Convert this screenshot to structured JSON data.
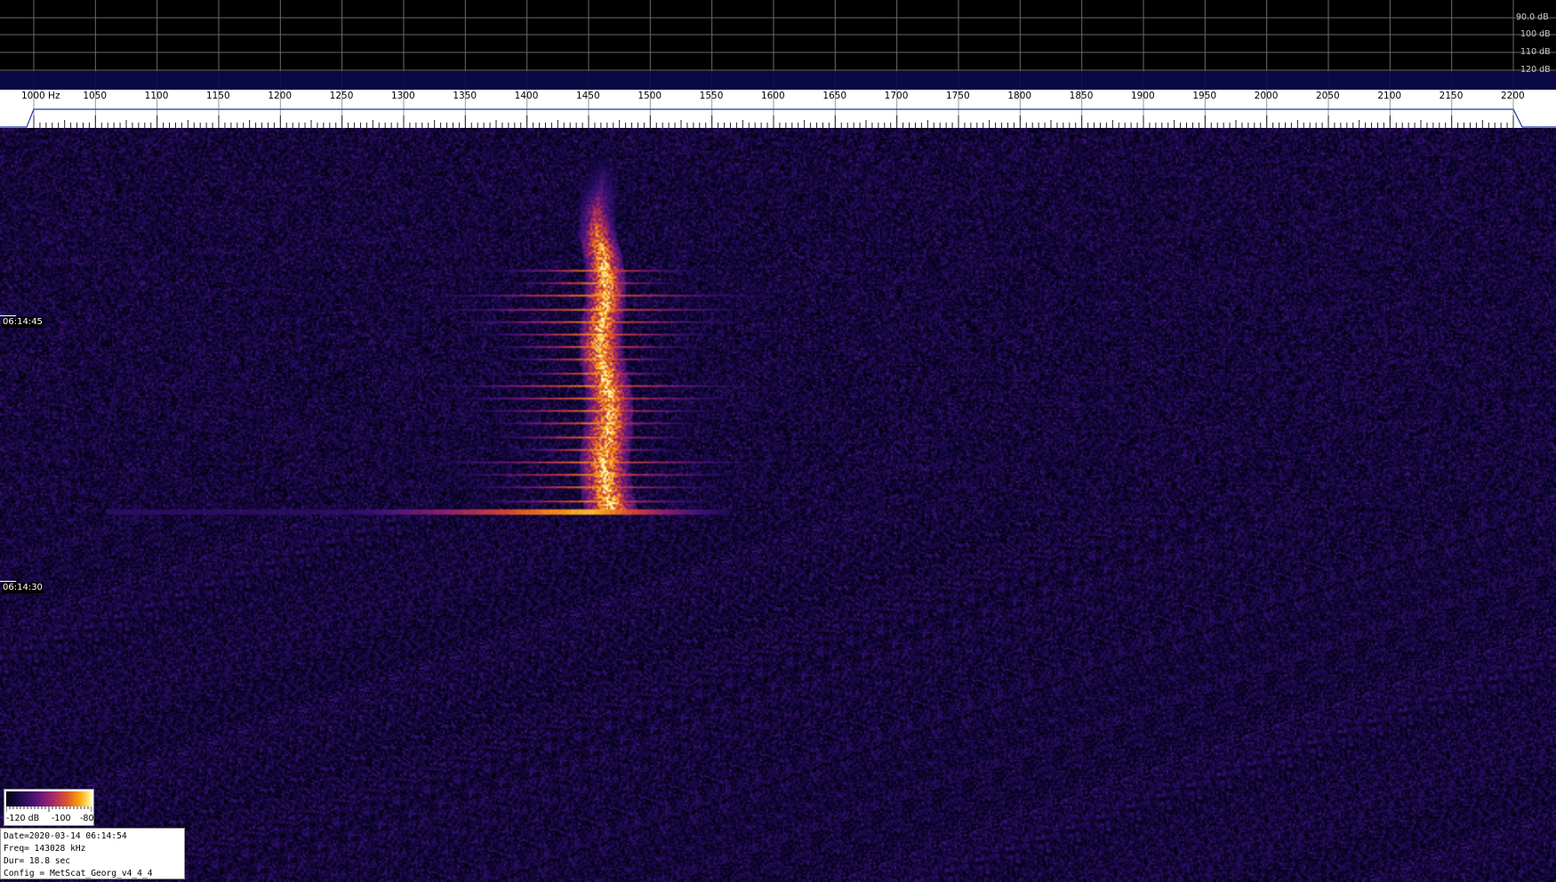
{
  "spectrum": {
    "db_labels": [
      "90.0 dB",
      "100 dB",
      "110 dB",
      "120 dB"
    ],
    "colors": {
      "avg_trace": "#2ee62e",
      "peak_trace": "#e02020",
      "grid": "#6a6a6a",
      "background": "#000000"
    }
  },
  "ruler": {
    "unit": "Hz",
    "freq_labels": [
      "1000",
      "1050",
      "1100",
      "1150",
      "1200",
      "1250",
      "1300",
      "1350",
      "1400",
      "1450",
      "1500",
      "1550",
      "1600",
      "1650",
      "1700",
      "1750",
      "1800",
      "1850",
      "1900",
      "1950",
      "2000",
      "2050",
      "2100",
      "2150",
      "2200"
    ],
    "first_label": "1000 Hz"
  },
  "waterfall": {
    "time_marks": [
      "06:14:45",
      "06:14:30"
    ],
    "signal_center_hz": 1450,
    "palette": "inferno"
  },
  "colorbar": {
    "labels": [
      "-120 dB",
      "-100",
      "-80"
    ]
  },
  "info": {
    "date": "Date=2020-03-14 06:14:54",
    "freq": "Freq= 143028 kHz",
    "duration": "Dur= 18.8 sec",
    "config": "Config = MetScat_Georg_v4_4_4"
  }
}
